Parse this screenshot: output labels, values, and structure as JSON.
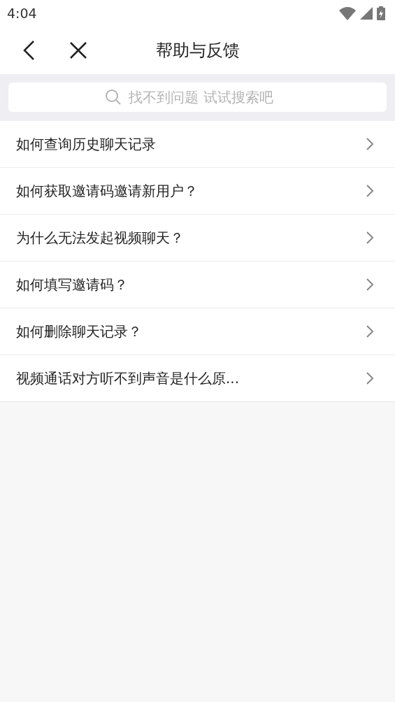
{
  "status_bar": {
    "time": "4:04"
  },
  "header": {
    "title": "帮助与反馈"
  },
  "search": {
    "placeholder": "找不到问题 试试搜索吧"
  },
  "questions": [
    {
      "text": "如何查询历史聊天记录"
    },
    {
      "text": "如何获取邀请码邀请新用户？"
    },
    {
      "text": "为什么无法发起视频聊天？"
    },
    {
      "text": "如何填写邀请码？"
    },
    {
      "text": "如何删除聊天记录？"
    },
    {
      "text": "视频通话对方听不到声音是什么原..."
    }
  ]
}
